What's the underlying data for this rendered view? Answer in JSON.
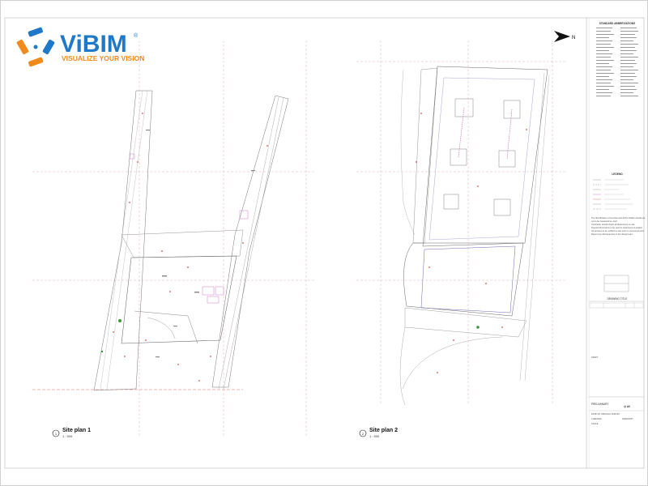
{
  "logo": {
    "name": "ViBIM",
    "registered": "®",
    "tagline": "VISUALIZE YOUR VISION"
  },
  "north_label": "N",
  "views": [
    {
      "number": "1",
      "title": "Site plan 1",
      "scale": "1 : 500"
    },
    {
      "number": "2",
      "title": "Site plan 2",
      "scale": "1 : 500"
    }
  ],
  "title_block": {
    "abbreviations_header": "STANDARD ABBREVIATIONS",
    "legend_header": "LEGEND",
    "notes": [
      "The identification of services and all the hidden details are",
      "not to be measured or used.",
      "Contractor should check all dimensions on site.",
      "Figured dimensions to be used in preference to scaled.",
      "All services to be verified on site prior to commencement.",
      "Report any discrepancies to the design team."
    ],
    "drawing_label": "DRAWING TITLE",
    "status_label": "DRAFT",
    "project_label": "PRELIMINARY",
    "sheet_size": "@ A0",
    "fields": [
      "DATE OF ORIGINAL SURVEY",
      "CHECKED",
      "DRAWN BY",
      "SCALE"
    ]
  }
}
